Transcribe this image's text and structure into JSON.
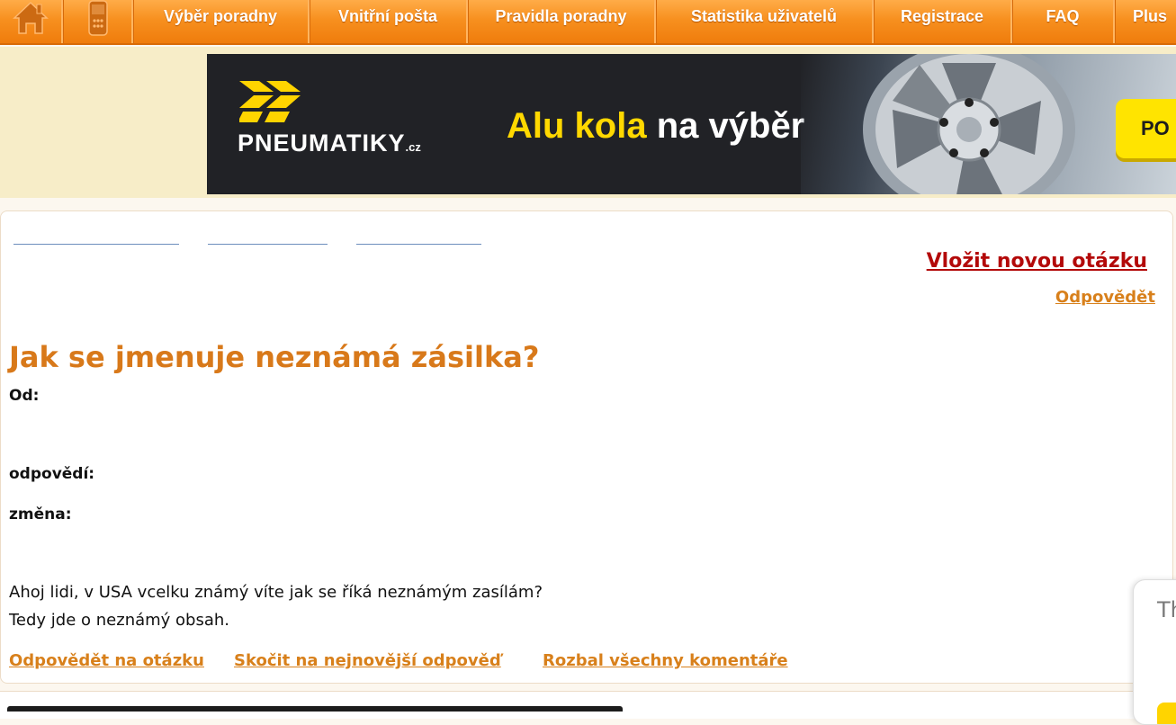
{
  "nav": {
    "items": [
      {
        "label": "Výběr poradny"
      },
      {
        "label": "Vnitřní pošta"
      },
      {
        "label": "Pravidla poradny"
      },
      {
        "label": "Statistika uživatelů"
      },
      {
        "label": "Registrace"
      },
      {
        "label": "FAQ"
      },
      {
        "label": "Plus"
      }
    ],
    "icons": [
      "home-icon",
      "mobile-phone-icon"
    ]
  },
  "banner": {
    "brand_name": "PNEUMATIKY",
    "brand_tld": ".cz",
    "promo_highlight": "Alu kola",
    "promo_rest": "na výběr",
    "cta_text": "PO"
  },
  "actions": {
    "new_question": "Vložit novou otázku",
    "answer": "Odpovědět"
  },
  "question": {
    "title": "Jak se jmenuje neznámá zásilka?",
    "from_label": "Od:",
    "answers_label": "odpovědí:",
    "changed_label": "změna:",
    "body": [
      "Ahoj lidi, v USA vcelku známý víte jak se říká neznámým zasílám?",
      "Tedy jde o neznámý obsah."
    ],
    "links": [
      "Odpovědět na otázku",
      "Skočit na nejnovější odpověď",
      "Rozbal všechny komentáře"
    ]
  },
  "popup": {
    "text": "Th yo w"
  },
  "colors": {
    "nav_orange": "#f7901f",
    "banner_background": "#f7edc8",
    "title_orange": "#d8791a",
    "link_orange": "#d8801b",
    "new_question_red": "#b30909",
    "promo_yellow": "#ffd800"
  }
}
